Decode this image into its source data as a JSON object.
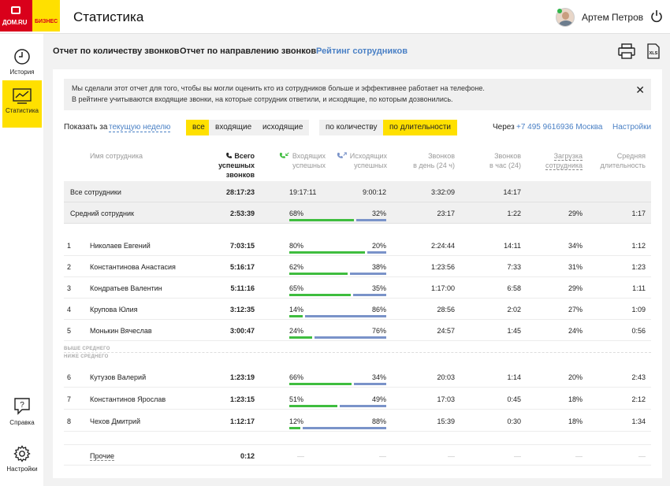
{
  "app": {
    "logo_text": "ДОМ.RU",
    "logo_sub": "БИЗНЕС",
    "title": "Статистика",
    "user_name": "Артем Петров"
  },
  "sidebar": {
    "items": [
      {
        "label": "История",
        "icon": "clock-icon"
      },
      {
        "label": "Статистика",
        "icon": "chart-icon",
        "active": true
      },
      {
        "label": "Справка",
        "icon": "help-bubble-icon"
      },
      {
        "label": "Настройки",
        "icon": "gear-icon"
      }
    ]
  },
  "tabs": [
    {
      "label": "Отчет по количеству звонков"
    },
    {
      "label": "Отчет по направлению звонков"
    },
    {
      "label": "Рейтинг сотрудников",
      "active": true
    }
  ],
  "notice": {
    "line1": "Мы сделали этот отчет для того, чтобы вы могли оценить кто из сотрудников больше и эффективнее работает на телефоне.",
    "line2": "В рейтинге учитываются входящие звонки, на которые сотрудник ответили, и исходящие, по которым дозвонились.",
    "close": "✕"
  },
  "filters": {
    "show_label": "Показать за",
    "period": "текущую неделю",
    "direction": [
      "все",
      "входящие",
      "исходящие"
    ],
    "direction_selected": "все",
    "sort": [
      "по количеству",
      "по длительности"
    ],
    "sort_selected": "по длительности",
    "via_label": "Через",
    "phone": "+7 495 9616936 Москва",
    "settings": "Настройки"
  },
  "table": {
    "headers": {
      "name": "Имя сотрудника",
      "total": [
        "Всего успешных",
        "звонков"
      ],
      "incoming": [
        "Входящих",
        "успешных"
      ],
      "outgoing": [
        "Исходящих",
        "успешных"
      ],
      "per_day": [
        "Звонков",
        "в день (24 ч)"
      ],
      "per_hour": [
        "Звонков",
        "в час (24)"
      ],
      "load": [
        "Загрузка",
        "сотрудника"
      ],
      "avg": [
        "Средняя",
        "длительность"
      ]
    },
    "summary": [
      {
        "name": "Все сотрудники",
        "total": "28:17:23",
        "incoming": "19:17:11",
        "outgoing": "9:00:12",
        "per_day": "3:32:09",
        "per_hour": "14:17",
        "load": "",
        "avg": ""
      },
      {
        "name": "Средний сотрудник",
        "total": "2:53:39",
        "in_pct": "68%",
        "out_pct": "32%",
        "in_frac": 0.68,
        "per_day": "23:17",
        "per_hour": "1:22",
        "load": "29%",
        "avg": "1:17"
      }
    ],
    "above": [
      {
        "n": "1",
        "name": "Николаев Евгений",
        "total": "7:03:15",
        "in_pct": "80%",
        "out_pct": "20%",
        "in_frac": 0.8,
        "per_day": "2:24:44",
        "per_hour": "14:11",
        "load": "34%",
        "avg": "1:12"
      },
      {
        "n": "2",
        "name": "Константинова Анастасия",
        "total": "5:16:17",
        "in_pct": "62%",
        "out_pct": "38%",
        "in_frac": 0.62,
        "per_day": "1:23:56",
        "per_hour": "7:33",
        "load": "31%",
        "avg": "1:23"
      },
      {
        "n": "3",
        "name": "Кондратьев Валентин",
        "total": "5:11:16",
        "in_pct": "65%",
        "out_pct": "35%",
        "in_frac": 0.65,
        "per_day": "1:17:00",
        "per_hour": "6:58",
        "load": "29%",
        "avg": "1:11"
      },
      {
        "n": "4",
        "name": "Крупова Юлия",
        "total": "3:12:35",
        "in_pct": "14%",
        "out_pct": "86%",
        "in_frac": 0.14,
        "per_day": "28:56",
        "per_hour": "2:02",
        "load": "27%",
        "avg": "1:09"
      },
      {
        "n": "5",
        "name": "Монькин Вячеслав",
        "total": "3:00:47",
        "in_pct": "24%",
        "out_pct": "76%",
        "in_frac": 0.24,
        "per_day": "24:57",
        "per_hour": "1:45",
        "load": "24%",
        "avg": "0:56"
      }
    ],
    "above_label": "ВЫШЕ СРЕДНЕГО",
    "below_label": "НИЖЕ СРЕДНЕГО",
    "below": [
      {
        "n": "6",
        "name": "Кутузов Валерий",
        "total": "1:23:19",
        "in_pct": "66%",
        "out_pct": "34%",
        "in_frac": 0.66,
        "per_day": "20:03",
        "per_hour": "1:14",
        "load": "20%",
        "avg": "2:43"
      },
      {
        "n": "7",
        "name": "Константинов Ярослав",
        "total": "1:23:15",
        "in_pct": "51%",
        "out_pct": "49%",
        "in_frac": 0.51,
        "per_day": "17:03",
        "per_hour": "0:45",
        "load": "18%",
        "avg": "2:12"
      },
      {
        "n": "8",
        "name": "Чехов Дмитрий",
        "total": "1:12:17",
        "in_pct": "12%",
        "out_pct": "88%",
        "in_frac": 0.12,
        "per_day": "15:39",
        "per_hour": "0:30",
        "load": "18%",
        "avg": "1:34"
      }
    ],
    "other": {
      "name": "Прочие",
      "total": "0:12",
      "dash": "—"
    }
  },
  "colors": {
    "brand_yellow": "#ffe000",
    "brand_red": "#d9001b",
    "link_blue": "#4a80c5",
    "incoming_green": "#3fbd3f",
    "outgoing_blue": "#7a93c9"
  }
}
